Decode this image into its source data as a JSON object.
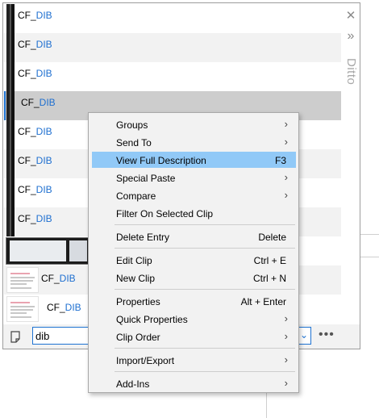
{
  "window": {
    "title_vertical": "Ditto",
    "close_icon": "close-icon",
    "expand_icon": "double-chevron-right-icon"
  },
  "clips": [
    {
      "prefix": "CF_",
      "keyword": "DIB",
      "thumb": "dark",
      "style": "plain"
    },
    {
      "prefix": "CF_",
      "keyword": "DIB",
      "thumb": "dark",
      "style": "alt"
    },
    {
      "prefix": "CF_",
      "keyword": "DIB",
      "thumb": "dark",
      "style": "plain"
    },
    {
      "prefix": "CF_",
      "keyword": "DIB",
      "thumb": "dark",
      "style": "selected"
    },
    {
      "prefix": "CF_",
      "keyword": "DIB",
      "thumb": "dark",
      "style": "plain"
    },
    {
      "prefix": "CF_",
      "keyword": "DIB",
      "thumb": "dark",
      "style": "alt"
    },
    {
      "prefix": "CF_",
      "keyword": "DIB",
      "thumb": "dark",
      "style": "plain"
    },
    {
      "prefix": "CF_",
      "keyword": "DIB",
      "thumb": "dark",
      "style": "alt"
    },
    {
      "prefix": "",
      "keyword": "",
      "thumb": "screenshot",
      "style": "plain"
    },
    {
      "prefix": "CF_",
      "keyword": "DIB",
      "thumb": "document",
      "style": "alt"
    },
    {
      "prefix": "CF_",
      "keyword": "DIB",
      "thumb": "document",
      "style": "plain"
    }
  ],
  "search": {
    "value": "dib",
    "note_icon": "note-icon",
    "dropdown_icon": "chevron-down-icon",
    "more_icon": "more-horizontal-icon"
  },
  "menu": {
    "items": [
      {
        "label": "Groups",
        "shortcut": "",
        "submenu": true
      },
      {
        "label": "Send To",
        "shortcut": "",
        "submenu": true
      },
      {
        "label": "View Full Description",
        "shortcut": "F3",
        "submenu": false,
        "highlighted": true
      },
      {
        "label": "Special Paste",
        "shortcut": "",
        "submenu": true
      },
      {
        "label": "Compare",
        "shortcut": "",
        "submenu": true
      },
      {
        "label": "Filter On Selected Clip",
        "shortcut": "",
        "submenu": false
      },
      {
        "label": "Delete Entry",
        "shortcut": "Delete",
        "submenu": false
      },
      {
        "label": "Edit Clip",
        "shortcut": "Ctrl + E",
        "submenu": false
      },
      {
        "label": "New Clip",
        "shortcut": "Ctrl + N",
        "submenu": false
      },
      {
        "label": "Properties",
        "shortcut": "Alt + Enter",
        "submenu": false
      },
      {
        "label": "Quick Properties",
        "shortcut": "",
        "submenu": true
      },
      {
        "label": "Clip Order",
        "shortcut": "",
        "submenu": true
      },
      {
        "label": "Import/Export",
        "shortcut": "",
        "submenu": true
      },
      {
        "label": "Add-Ins",
        "shortcut": "",
        "submenu": true
      }
    ],
    "submenu_arrow": "›"
  },
  "colors": {
    "highlight": "#91c9f7",
    "keyword": "#1e6fd0",
    "selection_bar": "#1e73d2"
  }
}
